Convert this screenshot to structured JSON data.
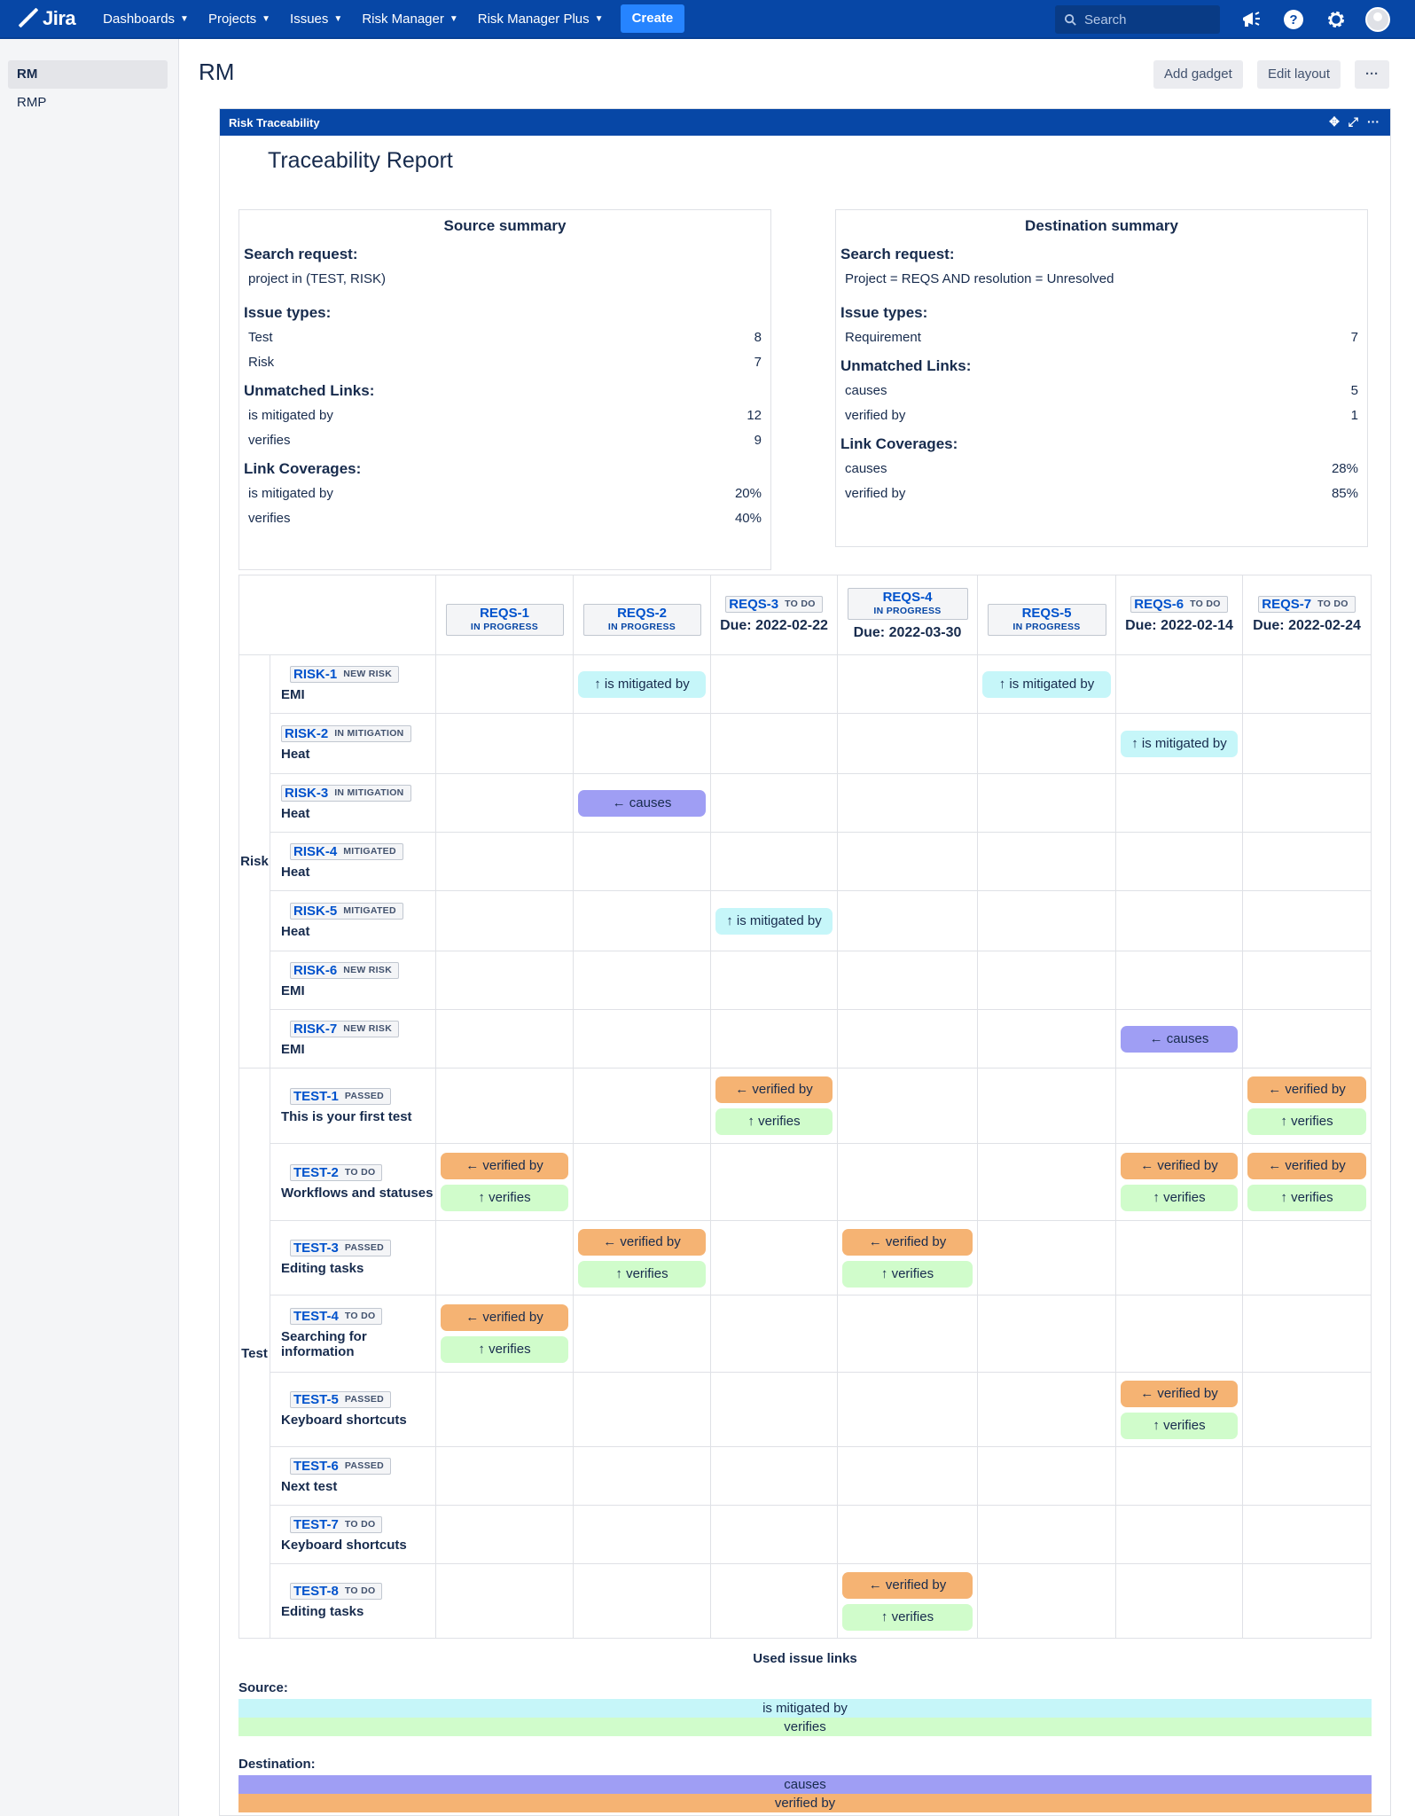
{
  "topnav": {
    "logo_text": "Jira",
    "items": [
      "Dashboards",
      "Projects",
      "Issues",
      "Risk Manager",
      "Risk Manager Plus"
    ],
    "create_label": "Create",
    "search_placeholder": "Search"
  },
  "sidebar": {
    "items": [
      "RM",
      "RMP"
    ]
  },
  "page": {
    "title": "RM",
    "add_gadget_label": "Add gadget",
    "edit_layout_label": "Edit layout",
    "more_label": "···"
  },
  "gadget": {
    "title": "Risk Traceability",
    "report_title": "Traceability Report"
  },
  "source_summary": {
    "heading": "Source summary",
    "search_request_label": "Search request:",
    "search_request": "project in (TEST, RISK)",
    "issue_types_label": "Issue types:",
    "issue_types": [
      {
        "name": "Test",
        "count": "8"
      },
      {
        "name": "Risk",
        "count": "7"
      }
    ],
    "unmatched_label": "Unmatched Links:",
    "unmatched": [
      {
        "name": "is mitigated by",
        "count": "12"
      },
      {
        "name": "verifies",
        "count": "9"
      }
    ],
    "coverage_label": "Link Coverages:",
    "coverage": [
      {
        "name": "is mitigated by",
        "value": "20%"
      },
      {
        "name": "verifies",
        "value": "40%"
      }
    ]
  },
  "destination_summary": {
    "heading": "Destination summary",
    "search_request_label": "Search request:",
    "search_request": "Project = REQS AND resolution = Unresolved",
    "issue_types_label": "Issue types:",
    "issue_types": [
      {
        "name": "Requirement",
        "count": "7"
      }
    ],
    "unmatched_label": "Unmatched Links:",
    "unmatched": [
      {
        "name": "causes",
        "count": "5"
      },
      {
        "name": "verified by",
        "count": "1"
      }
    ],
    "coverage_label": "Link Coverages:",
    "coverage": [
      {
        "name": "causes",
        "value": "28%"
      },
      {
        "name": "verified by",
        "value": "85%"
      }
    ]
  },
  "matrix": {
    "columns": [
      {
        "key": "REQS-1",
        "status": "IN PROGRESS",
        "due": ""
      },
      {
        "key": "REQS-2",
        "status": "IN PROGRESS",
        "due": ""
      },
      {
        "key": "REQS-3",
        "status": "TO DO",
        "due": "Due: 2022-02-22"
      },
      {
        "key": "REQS-4",
        "status": "IN PROGRESS",
        "due": "Due: 2022-03-30"
      },
      {
        "key": "REQS-5",
        "status": "IN PROGRESS",
        "due": ""
      },
      {
        "key": "REQS-6",
        "status": "TO DO",
        "due": "Due: 2022-02-14"
      },
      {
        "key": "REQS-7",
        "status": "TO DO",
        "due": "Due: 2022-02-24"
      }
    ],
    "groups": [
      "Risk",
      "Test"
    ],
    "rows": [
      {
        "key": "RISK-1",
        "status": "NEW RISK",
        "title": "EMI"
      },
      {
        "key": "RISK-2",
        "status": "IN MITIGATION",
        "title": "Heat"
      },
      {
        "key": "RISK-3",
        "status": "IN MITIGATION",
        "title": "Heat"
      },
      {
        "key": "RISK-4",
        "status": "MITIGATED",
        "title": "Heat"
      },
      {
        "key": "RISK-5",
        "status": "MITIGATED",
        "title": "Heat"
      },
      {
        "key": "RISK-6",
        "status": "NEW RISK",
        "title": "EMI"
      },
      {
        "key": "RISK-7",
        "status": "NEW RISK",
        "title": "EMI"
      },
      {
        "key": "TEST-1",
        "status": "PASSED",
        "title": "This is your first test"
      },
      {
        "key": "TEST-2",
        "status": "TO DO",
        "title": "Workflows and statuses"
      },
      {
        "key": "TEST-3",
        "status": "PASSED",
        "title": "Editing tasks"
      },
      {
        "key": "TEST-4",
        "status": "TO DO",
        "title": "Searching for information"
      },
      {
        "key": "TEST-5",
        "status": "PASSED",
        "title": "Keyboard shortcuts"
      },
      {
        "key": "TEST-6",
        "status": "PASSED",
        "title": "Next test"
      },
      {
        "key": "TEST-7",
        "status": "TO DO",
        "title": "Keyboard shortcuts"
      },
      {
        "key": "TEST-8",
        "status": "TO DO",
        "title": "Editing tasks"
      }
    ],
    "link_labels": {
      "mit": "↑ is mitigated by",
      "cau": "← causes",
      "vb": "← verified by",
      "ver": "↑ verifies"
    },
    "cells": {
      "RISK-1": {
        "1": [
          "mit"
        ],
        "4": [
          "mit"
        ]
      },
      "RISK-2": {
        "5": [
          "mit"
        ]
      },
      "RISK-3": {
        "1": [
          "cau"
        ]
      },
      "RISK-5": {
        "2": [
          "mit"
        ]
      },
      "RISK-7": {
        "5": [
          "cau"
        ]
      },
      "TEST-1": {
        "2": [
          "vb",
          "ver"
        ],
        "6": [
          "vb",
          "ver"
        ]
      },
      "TEST-2": {
        "0": [
          "vb",
          "ver"
        ],
        "5": [
          "vb",
          "ver"
        ],
        "6": [
          "vb",
          "ver"
        ]
      },
      "TEST-3": {
        "1": [
          "vb",
          "ver"
        ],
        "3": [
          "vb",
          "ver"
        ]
      },
      "TEST-4": {
        "0": [
          "vb",
          "ver"
        ]
      },
      "TEST-5": {
        "5": [
          "vb",
          "ver"
        ]
      },
      "TEST-8": {
        "3": [
          "vb",
          "ver"
        ]
      }
    }
  },
  "legend": {
    "title": "Used issue links",
    "source_label": "Source:",
    "source": [
      {
        "name": "is mitigated by",
        "color": "#c6f6f9"
      },
      {
        "name": "verifies",
        "color": "#d0fccb"
      }
    ],
    "destination_label": "Destination:",
    "destination": [
      {
        "name": "causes",
        "color": "#9f9ef4"
      },
      {
        "name": "verified by",
        "color": "#f5b373"
      }
    ]
  }
}
